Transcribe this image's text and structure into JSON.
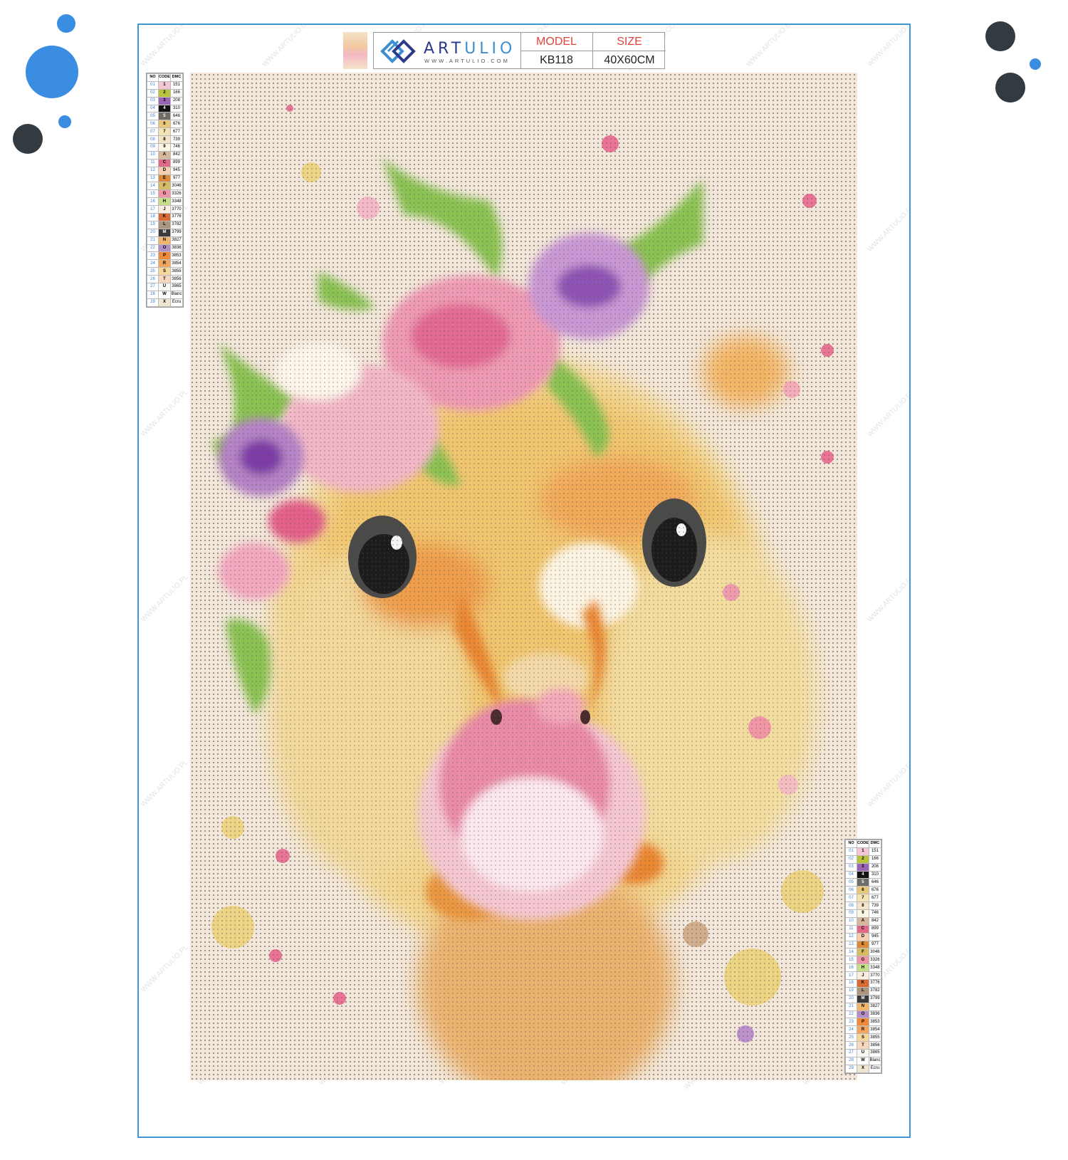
{
  "header": {
    "brand": "ARTULIO",
    "brand_url": "WWW.ARTULIO.COM",
    "model_label": "MODEL",
    "model_value": "KB118",
    "size_label": "SIZE",
    "size_value": "40X60CM"
  },
  "legend": {
    "headers": [
      "NO",
      "CODE",
      "DMC"
    ],
    "rows": [
      {
        "no": "01",
        "code": "1",
        "dmc": "151",
        "color": "#f4c6d3"
      },
      {
        "no": "02",
        "code": "2",
        "dmc": "166",
        "color": "#b9c43c"
      },
      {
        "no": "03",
        "code": "3",
        "dmc": "208",
        "color": "#9b63b4"
      },
      {
        "no": "04",
        "code": "4",
        "dmc": "310",
        "color": "#111111"
      },
      {
        "no": "05",
        "code": "5",
        "dmc": "646",
        "color": "#6f6d66"
      },
      {
        "no": "06",
        "code": "6",
        "dmc": "676",
        "color": "#e8c77a"
      },
      {
        "no": "07",
        "code": "7",
        "dmc": "677",
        "color": "#f4e4b4"
      },
      {
        "no": "08",
        "code": "8",
        "dmc": "739",
        "color": "#f3e3c7"
      },
      {
        "no": "09",
        "code": "9",
        "dmc": "746",
        "color": "#fbf6e4"
      },
      {
        "no": "10",
        "code": "A",
        "dmc": "842",
        "color": "#d7b79c"
      },
      {
        "no": "11",
        "code": "C",
        "dmc": "899",
        "color": "#e06a85"
      },
      {
        "no": "12",
        "code": "D",
        "dmc": "945",
        "color": "#f6cfb0"
      },
      {
        "no": "13",
        "code": "E",
        "dmc": "977",
        "color": "#dd8a36"
      },
      {
        "no": "14",
        "code": "F",
        "dmc": "3046",
        "color": "#d5bc62"
      },
      {
        "no": "15",
        "code": "G",
        "dmc": "3326",
        "color": "#f095a8"
      },
      {
        "no": "16",
        "code": "H",
        "dmc": "3348",
        "color": "#c7df8a"
      },
      {
        "no": "17",
        "code": "J",
        "dmc": "3770",
        "color": "#fbeee0"
      },
      {
        "no": "18",
        "code": "K",
        "dmc": "3776",
        "color": "#d96b35"
      },
      {
        "no": "19",
        "code": "L",
        "dmc": "3782",
        "color": "#a9967d"
      },
      {
        "no": "20",
        "code": "M",
        "dmc": "3799",
        "color": "#3a3a3a"
      },
      {
        "no": "21",
        "code": "N",
        "dmc": "3827",
        "color": "#f2b56c"
      },
      {
        "no": "22",
        "code": "O",
        "dmc": "3836",
        "color": "#b48ec7"
      },
      {
        "no": "23",
        "code": "P",
        "dmc": "3853",
        "color": "#f08a3a"
      },
      {
        "no": "24",
        "code": "R",
        "dmc": "3854",
        "color": "#f2a55e"
      },
      {
        "no": "25",
        "code": "S",
        "dmc": "3855",
        "color": "#f6d69a"
      },
      {
        "no": "26",
        "code": "T",
        "dmc": "3856",
        "color": "#fbd8bd"
      },
      {
        "no": "27",
        "code": "U",
        "dmc": "3865",
        "color": "#faf8f2"
      },
      {
        "no": "28",
        "code": "W",
        "dmc": "Blanc",
        "color": "#ffffff"
      },
      {
        "no": "29",
        "code": "X",
        "dmc": "Ecru",
        "color": "#efe6d2"
      }
    ]
  },
  "watermarks": [
    "WWW.ARTULIO.PL",
    "WWW.ARTULIO.DE",
    "WWW.ARTULIO.IT",
    "WWW.ARTULIO.ES",
    "WWW.ARTULIO.CO.UK",
    "WWW.ARTULIO.EU",
    "WWW.ARTULIO.FR"
  ],
  "colors": {
    "frame": "#3f97d4",
    "brand_dark": "#2c3a8a",
    "brand_blue": "#3b8fd1",
    "accent_red": "#e0443e",
    "dot_blue": "#3a8de0",
    "dot_dark": "#333a40"
  }
}
